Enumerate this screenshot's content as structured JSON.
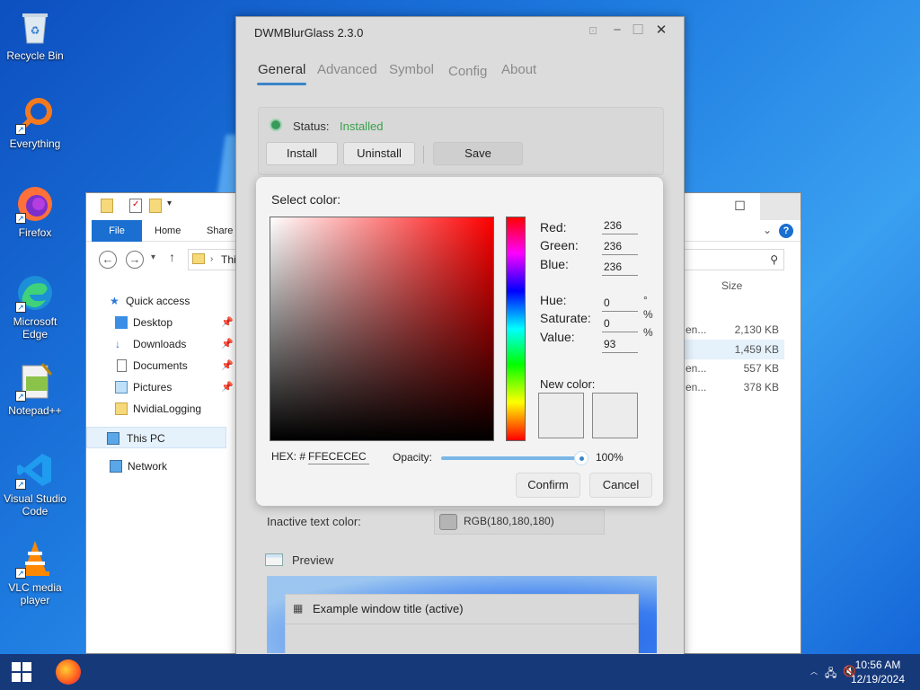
{
  "desktop": {
    "icons": [
      {
        "label": "Recycle Bin"
      },
      {
        "label": "Everything"
      },
      {
        "label": "Firefox"
      },
      {
        "label": "Microsoft Edge"
      },
      {
        "label": "Notepad++"
      },
      {
        "label": "Visual Studio Code"
      },
      {
        "label": "VLC media player"
      }
    ]
  },
  "taskbar": {
    "time": "10:56 AM",
    "date": "12/19/2024"
  },
  "explorer": {
    "ribbon_tabs": [
      "File",
      "Home",
      "Share"
    ],
    "address_text": "Thi",
    "column_size": "Size",
    "nav": {
      "quick_access": "Quick access",
      "items": [
        "Desktop",
        "Downloads",
        "Documents",
        "Pictures",
        "NvidiaLogging"
      ],
      "this_pc": "This PC",
      "network": "Network"
    },
    "files": [
      {
        "name": "en...",
        "size": "2,130 KB"
      },
      {
        "name": "",
        "size": "1,459 KB"
      },
      {
        "name": "en...",
        "size": "557 KB"
      },
      {
        "name": "en...",
        "size": "378 KB"
      }
    ]
  },
  "dwm": {
    "title": "DWMBlurGlass 2.3.0",
    "tabs": [
      "General",
      "Advanced",
      "Symbol",
      "Config",
      "About"
    ],
    "status_label": "Status:",
    "status_value": "Installed",
    "buttons": {
      "install": "Install",
      "uninstall": "Uninstall",
      "save": "Save"
    },
    "inactive_text_color_label": "Inactive text color:",
    "inactive_text_color_value": "RGB(180,180,180)",
    "preview_label": "Preview",
    "example_title": "Example window title (active)"
  },
  "color_picker": {
    "title": "Select color:",
    "red_label": "Red:",
    "red": "236",
    "green_label": "Green:",
    "green": "236",
    "blue_label": "Blue:",
    "blue": "236",
    "hue_label": "Hue:",
    "hue": "0",
    "hue_unit": "°",
    "saturate_label": "Saturate:",
    "saturate": "0",
    "saturate_unit": "%",
    "value_label": "Value:",
    "value": "93",
    "value_unit": "%",
    "new_color_label": "New color:",
    "hex_label": "HEX: #",
    "hex": "FFECECEC",
    "opacity_label": "Opacity:",
    "opacity": "100%",
    "confirm": "Confirm",
    "cancel": "Cancel"
  },
  "colors": {
    "accent": "#3b84c9",
    "status_green": "#3aa04a",
    "selected_color": "#ececec"
  }
}
